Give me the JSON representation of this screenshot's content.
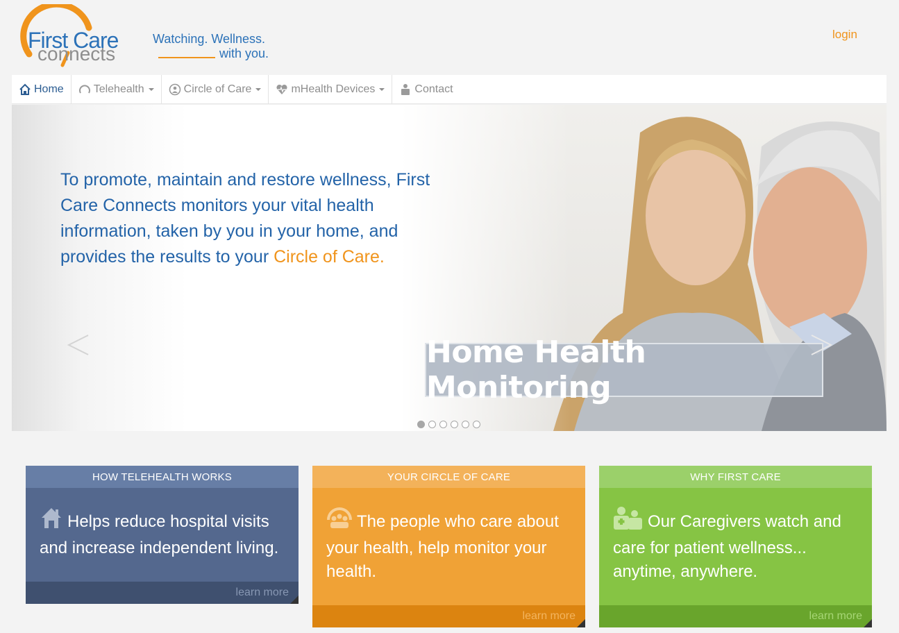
{
  "header": {
    "logo": {
      "line1": "First Care",
      "line2": "connects"
    },
    "tagline_line1": "Watching. Wellness.",
    "tagline_line2": "with you.",
    "login": "login"
  },
  "nav": {
    "items": [
      {
        "label": "Home",
        "icon": "home-icon",
        "dropdown": false,
        "active": true
      },
      {
        "label": "Telehealth",
        "icon": "telehealth-icon",
        "dropdown": true
      },
      {
        "label": "Circle of Care",
        "icon": "circle-of-care-icon",
        "dropdown": true
      },
      {
        "label": "mHealth Devices",
        "icon": "heart-pulse-icon",
        "dropdown": true
      },
      {
        "label": "Contact",
        "icon": "contact-icon",
        "dropdown": false
      }
    ]
  },
  "hero": {
    "text": "To promote, maintain and restore wellness, First Care Connects monitors your vital health information, taken by you in your home, and provides the results to your",
    "highlight": "Circle of Care.",
    "banner": "Home Health Monitoring",
    "slides_total": 6,
    "slide_active": 1
  },
  "cards": [
    {
      "title": "HOW TELEHEALTH WORKS",
      "text": "Helps reduce hospital visits and increase independent living.",
      "link": "learn more",
      "icon": "house-icon",
      "color": "#54688e"
    },
    {
      "title": "YOUR CIRCLE OF CARE",
      "text": "The people who care about your health, help monitor your health.",
      "link": "learn more",
      "icon": "family-icon",
      "color": "#f0a236"
    },
    {
      "title": "WHY FIRST CARE",
      "text": "Our Caregivers watch and care for patient wellness... anytime, anywhere.",
      "link": "learn more",
      "icon": "caregivers-icon",
      "color": "#86c444"
    }
  ],
  "colors": {
    "brand_blue": "#2c72b8",
    "brand_orange": "#f0941c"
  }
}
